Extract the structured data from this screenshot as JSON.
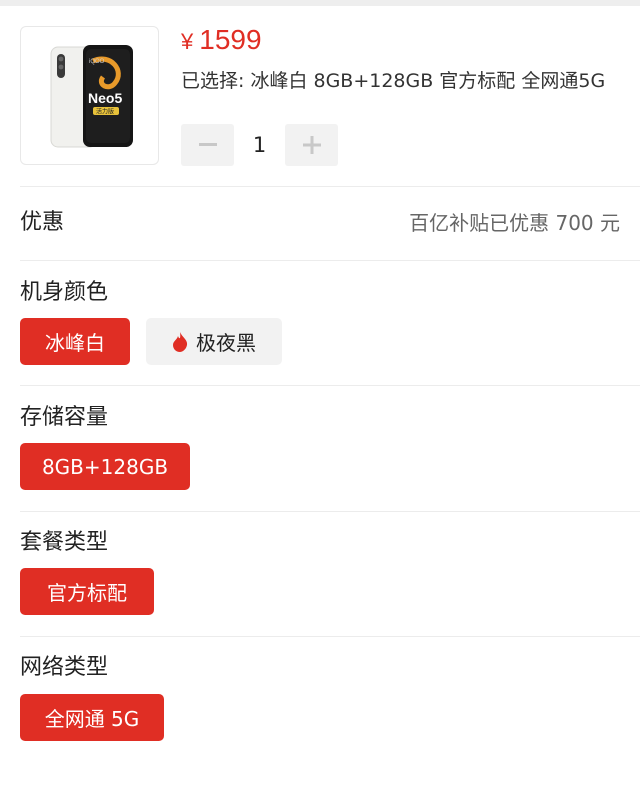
{
  "product": {
    "image_alt": "iQOO Neo5 活力版",
    "image_brand": "iQOO",
    "image_model": "Neo5",
    "image_edition": "活力版",
    "currency": "¥",
    "price": "1599",
    "selected_text": "已选择: 冰峰白 8GB+128GB 官方标配 全网通5G"
  },
  "quantity": {
    "value": "1",
    "minus_icon": "minus-icon",
    "plus_icon": "plus-icon"
  },
  "discount": {
    "label": "优惠",
    "value": "百亿补贴已优惠 700 元"
  },
  "sections": {
    "color": {
      "title": "机身颜色",
      "options": [
        {
          "label": "冰峰白",
          "selected": true
        },
        {
          "label": "极夜黑",
          "selected": false,
          "icon": "flame-icon"
        }
      ]
    },
    "storage": {
      "title": "存储容量",
      "options": [
        {
          "label": "8GB+128GB",
          "selected": true
        }
      ]
    },
    "package": {
      "title": "套餐类型",
      "options": [
        {
          "label": "官方标配",
          "selected": true
        }
      ]
    },
    "network": {
      "title": "网络类型",
      "options": [
        {
          "label": "全网通 5G",
          "selected": true
        }
      ]
    }
  },
  "colors": {
    "accent": "#e02e24",
    "chip_inactive": "#f2f2f2",
    "divider": "#ececec"
  }
}
